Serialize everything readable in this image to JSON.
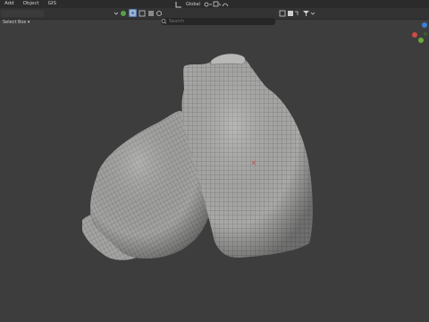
{
  "menu": {
    "items": [
      "Add",
      "Object",
      "GIS"
    ]
  },
  "toolbar": {
    "select_mode": "Select Box ▾",
    "transform_orientation": "Global",
    "search_placeholder": "Search"
  },
  "colors": {
    "background": "#3d3d3d",
    "menubar": "#2b2b2b",
    "mesh_fill": "#a9aaa8",
    "mesh_wire": "#474a48",
    "gizmo_x": "#d04a4a",
    "gizmo_y": "#6aaa34",
    "gizmo_z": "#3d7fd6"
  },
  "icons": [
    "sync-icon",
    "select-mode-icon",
    "search-icon",
    "transform-icon",
    "snap-icon",
    "proportional-icon",
    "overlay-icon",
    "filter-icon",
    "dropdown-icon"
  ]
}
